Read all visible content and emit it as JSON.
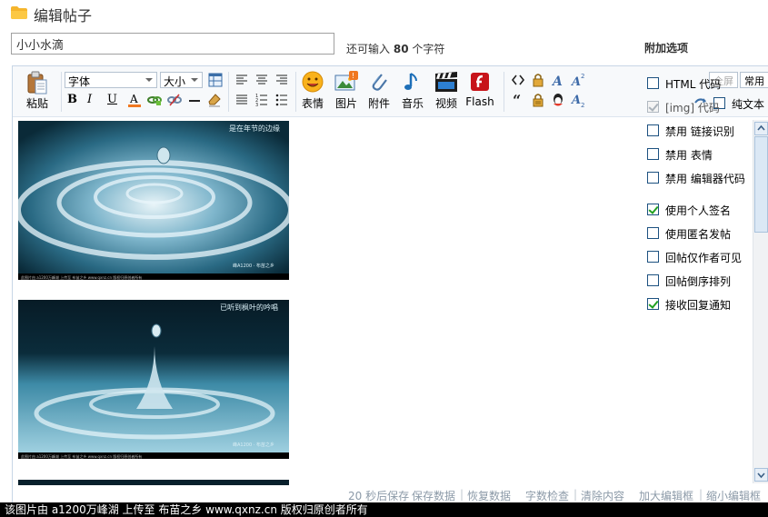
{
  "header": {
    "title": "编辑帖子",
    "icon": "folder-icon"
  },
  "subject": {
    "value": "小小水滴",
    "remain_prefix": "还可输入",
    "remain_count": "80",
    "remain_suffix": "个字符"
  },
  "toolbar": {
    "paste": "粘贴",
    "font_select": "字体",
    "size_select": "大小",
    "emoticon": "表情",
    "image": "图片",
    "attachment": "附件",
    "music": "音乐",
    "video": "视频",
    "flash": "Flash",
    "fullscreen": "全屏",
    "common": "常用",
    "plain_text": "纯文本"
  },
  "extra_options": {
    "title": "附加选项",
    "items": [
      {
        "label": "HTML 代码",
        "checked": false,
        "disabled": false
      },
      {
        "label": "[img] 代码",
        "checked": true,
        "disabled": true
      },
      {
        "label": "禁用 链接识别",
        "checked": false,
        "disabled": false
      },
      {
        "label": "禁用 表情",
        "checked": false,
        "disabled": false
      },
      {
        "label": "禁用 编辑器代码",
        "checked": false,
        "disabled": false
      },
      {
        "label": "使用个人签名",
        "checked": true,
        "disabled": false
      },
      {
        "label": "使用匿名发帖",
        "checked": false,
        "disabled": false
      },
      {
        "label": "回帖仅作者可见",
        "checked": false,
        "disabled": false
      },
      {
        "label": "回帖倒序排列",
        "checked": false,
        "disabled": false
      },
      {
        "label": "接收回复通知",
        "checked": true,
        "disabled": false
      }
    ]
  },
  "content": {
    "images": [
      {
        "caption_top": "是在年节的边缘",
        "caption_bottom": "此图片由 a1200万峰湖 上传至 布苗之乡 www.qxnz.cn 版权归原创者所有",
        "watermark": "峰A1200 · 布苗之乡"
      },
      {
        "caption_top": "已听到枫叶的吟唱",
        "caption_bottom": "此图片由 a1200万峰湖 上传至 布苗之乡 www.qxnz.cn 版权归原创者所有",
        "watermark": "峰A1200 · 布苗之乡"
      }
    ]
  },
  "status_bar": {
    "autosave": "20 秒后保存",
    "save": "保存数据",
    "restore": "恢复数据",
    "check": "字数检查",
    "clear": "清除内容",
    "enlarge": "加大编辑框",
    "shrink": "缩小编辑框"
  },
  "footer": {
    "text": "该图片由 a1200万峰湖 上传至 布苗之乡 www.qxnz.cn 版权归原创者所有"
  },
  "colors": {
    "frame_border": "#c7d6e6",
    "check_green": "#21a121",
    "status_text": "#8c9aa8"
  }
}
